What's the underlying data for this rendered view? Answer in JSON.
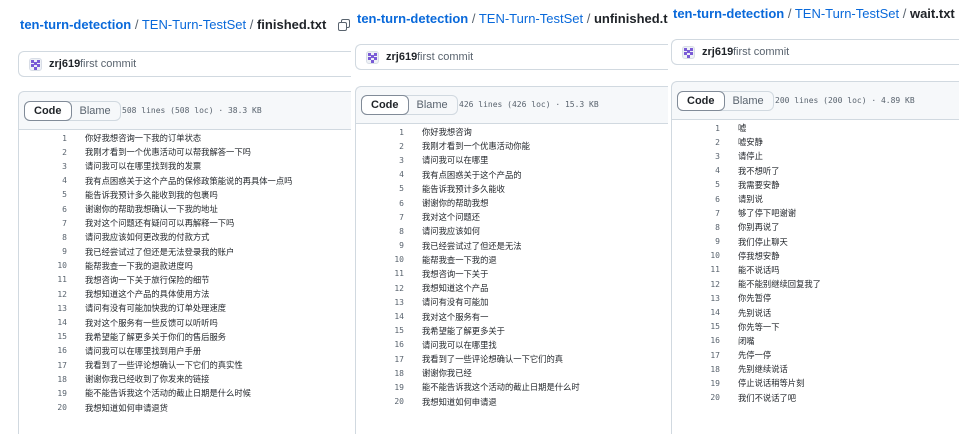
{
  "panels": [
    {
      "repo": "ten-turn-detection",
      "dir": "TEN-Turn-TestSet",
      "file": "finished.txt",
      "commit_user": "zrj619",
      "commit_msg": "first commit",
      "tab_code": "Code",
      "tab_blame": "Blame",
      "meta": "508 lines (508 loc) · 38.3 KB",
      "lines": [
        {
          "n": "1",
          "t": "你好我想咨询一下我的订单状态"
        },
        {
          "n": "2",
          "t": "我刚才看到一个优惠活动可以帮我解答一下吗"
        },
        {
          "n": "3",
          "t": "请问我可以在哪里找到我的发票"
        },
        {
          "n": "4",
          "t": "我有点困惑关于这个产品的保修政策能说的再具体一点吗"
        },
        {
          "n": "5",
          "t": "能告诉我预计多久能收到我的包裹吗"
        },
        {
          "n": "6",
          "t": "谢谢你的帮助我想确认一下我的地址"
        },
        {
          "n": "7",
          "t": "我对这个问题还有疑问可以再解释一下吗"
        },
        {
          "n": "8",
          "t": "请问我应该如何更改我的付款方式"
        },
        {
          "n": "9",
          "t": "我已经尝试过了但还是无法登录我的账户"
        },
        {
          "n": "10",
          "t": "能帮我查一下我的退款进度吗"
        },
        {
          "n": "11",
          "t": "我想咨询一下关于旅行保险的细节"
        },
        {
          "n": "12",
          "t": "我想知道这个产品的具体使用方法"
        },
        {
          "n": "13",
          "t": "请问有没有可能加快我的订单处理速度"
        },
        {
          "n": "14",
          "t": "我对这个服务有一些反馈可以听听吗"
        },
        {
          "n": "15",
          "t": "我希望能了解更多关于你们的售后服务"
        },
        {
          "n": "16",
          "t": "请问我可以在哪里找到用户手册"
        },
        {
          "n": "17",
          "t": "我看到了一些评论想确认一下它们的真实性"
        },
        {
          "n": "18",
          "t": "谢谢你我已经收到了你发来的链接"
        },
        {
          "n": "19",
          "t": "能不能告诉我这个活动的截止日期是什么时候"
        },
        {
          "n": "20",
          "t": "我想知道如何申请退货"
        }
      ]
    },
    {
      "repo": "ten-turn-detection",
      "dir": "TEN-Turn-TestSet",
      "file": "unfinished.txt",
      "commit_user": "zrj619",
      "commit_msg": "first commit",
      "tab_code": "Code",
      "tab_blame": "Blame",
      "meta": "426 lines (426 loc) · 15.3 KB",
      "lines": [
        {
          "n": "1",
          "t": "你好我想咨询"
        },
        {
          "n": "2",
          "t": "我刚才看到一个优惠活动你能"
        },
        {
          "n": "3",
          "t": "请问我可以在哪里"
        },
        {
          "n": "4",
          "t": "我有点困惑关于这个产品的"
        },
        {
          "n": "5",
          "t": "能告诉我预计多久能收"
        },
        {
          "n": "6",
          "t": "谢谢你的帮助我想"
        },
        {
          "n": "7",
          "t": "我对这个问题还"
        },
        {
          "n": "8",
          "t": "请问我应该如何"
        },
        {
          "n": "9",
          "t": "我已经尝试过了但还是无法"
        },
        {
          "n": "10",
          "t": "能帮我查一下我的退"
        },
        {
          "n": "11",
          "t": "我想咨询一下关于"
        },
        {
          "n": "12",
          "t": "我想知道这个产品"
        },
        {
          "n": "13",
          "t": "请问有没有可能加"
        },
        {
          "n": "14",
          "t": "我对这个服务有一"
        },
        {
          "n": "15",
          "t": "我希望能了解更多关于"
        },
        {
          "n": "16",
          "t": "请问我可以在哪里找"
        },
        {
          "n": "17",
          "t": "我看到了一些评论想确认一下它们的真"
        },
        {
          "n": "18",
          "t": "谢谢你我已经"
        },
        {
          "n": "19",
          "t": "能不能告诉我这个活动的截止日期是什么时"
        },
        {
          "n": "20",
          "t": "我想知道如何申请退"
        }
      ]
    },
    {
      "repo": "ten-turn-detection",
      "dir": "TEN-Turn-TestSet",
      "file": "wait.txt",
      "commit_user": "zrj619",
      "commit_msg": "first commit",
      "tab_code": "Code",
      "tab_blame": "Blame",
      "meta": "200 lines (200 loc) · 4.89 KB",
      "lines": [
        {
          "n": "1",
          "t": "嘘"
        },
        {
          "n": "2",
          "t": "嘘安静"
        },
        {
          "n": "3",
          "t": "请停止"
        },
        {
          "n": "4",
          "t": "我不想听了"
        },
        {
          "n": "5",
          "t": "我需要安静"
        },
        {
          "n": "6",
          "t": "请别说"
        },
        {
          "n": "7",
          "t": "够了停下吧谢谢"
        },
        {
          "n": "8",
          "t": "你别再说了"
        },
        {
          "n": "9",
          "t": "我们停止聊天"
        },
        {
          "n": "10",
          "t": "停我想安静"
        },
        {
          "n": "11",
          "t": "能不说话吗"
        },
        {
          "n": "12",
          "t": "能不能别继续回复我了"
        },
        {
          "n": "13",
          "t": "你先暂停"
        },
        {
          "n": "14",
          "t": "先别说话"
        },
        {
          "n": "15",
          "t": "你先等一下"
        },
        {
          "n": "16",
          "t": "闭嘴"
        },
        {
          "n": "17",
          "t": "先停一停"
        },
        {
          "n": "18",
          "t": "先别继续说话"
        },
        {
          "n": "19",
          "t": "停止说话稍等片刻"
        },
        {
          "n": "20",
          "t": "我们不说话了吧"
        }
      ]
    }
  ]
}
